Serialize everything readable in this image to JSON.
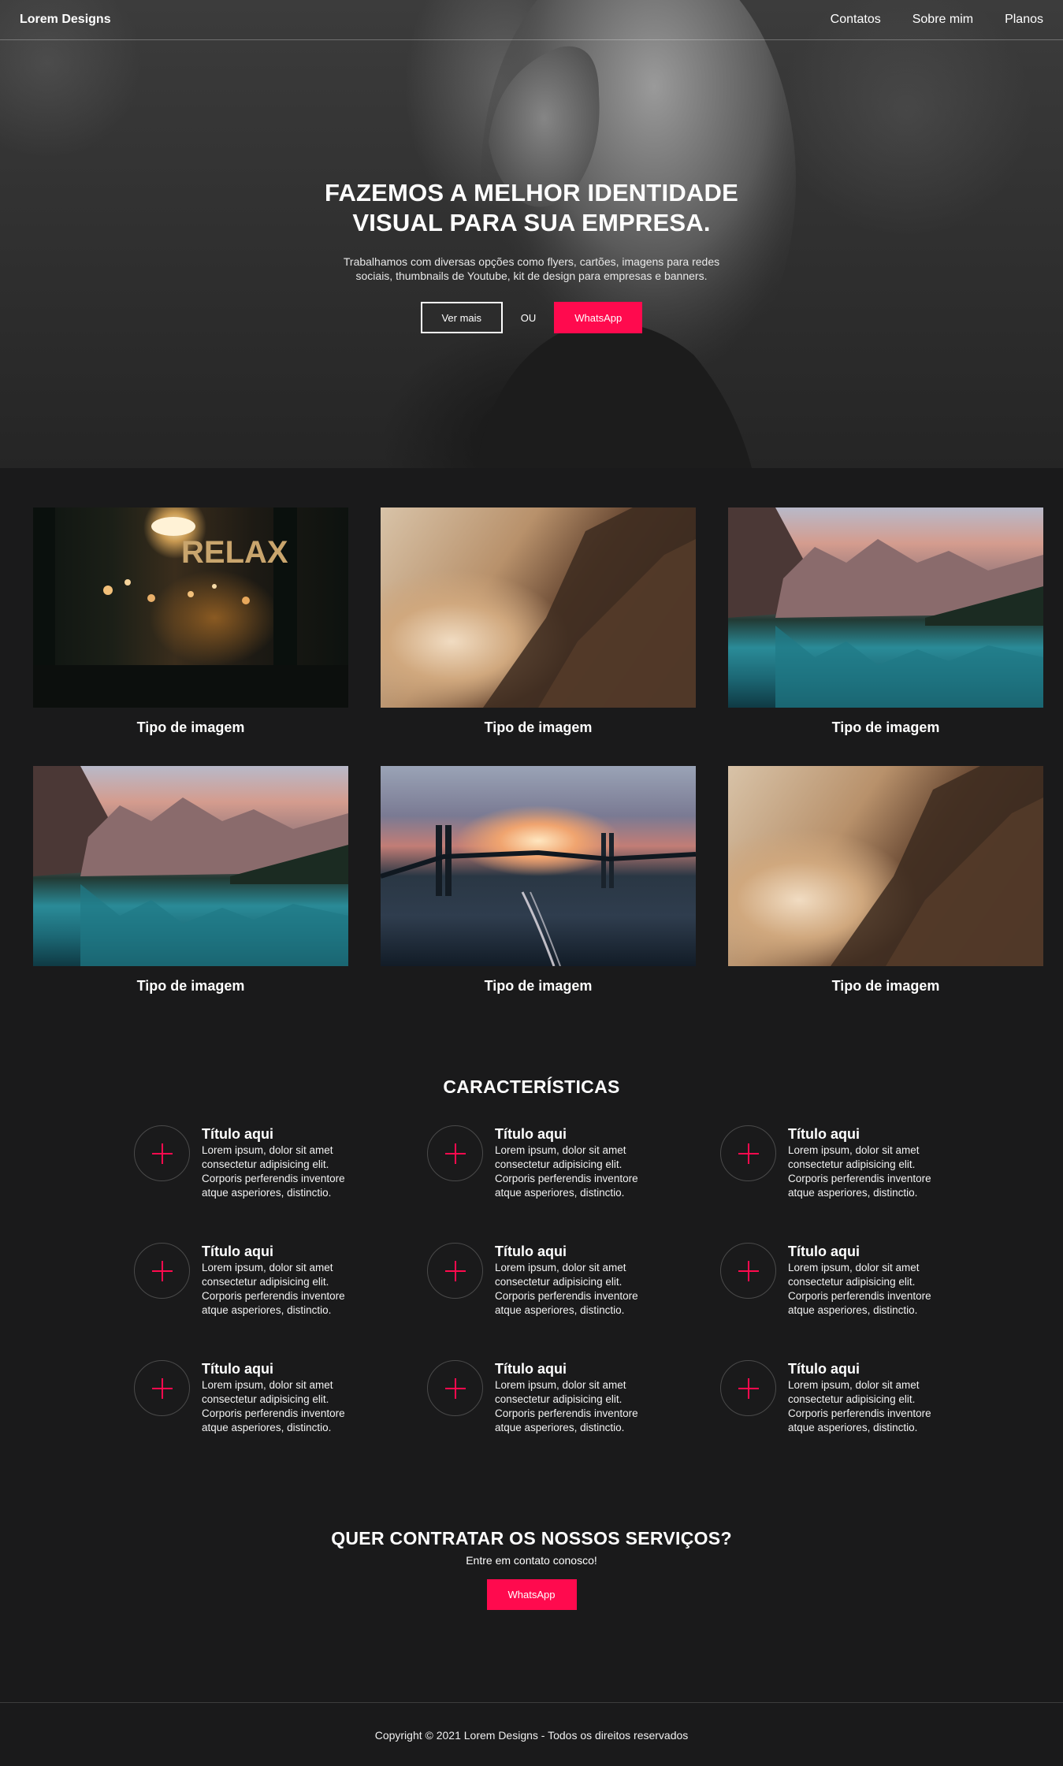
{
  "nav": {
    "brand": "Lorem Designs",
    "links": [
      "Contatos",
      "Sobre mim",
      "Planos"
    ]
  },
  "hero": {
    "title": "FAZEMOS A MELHOR IDENTIDADE VISUAL PARA SUA EMPRESA.",
    "subtitle": "Trabalhamos com diversas opções como flyers, cartões, imagens para redes sociais, thumbnails de Youtube, kit de design para empresas e banners.",
    "primary_label": "Ver mais",
    "or_label": "OU",
    "whatsapp_label": "WhatsApp"
  },
  "gallery": {
    "items": [
      {
        "title": "Tipo de imagem",
        "image": "bar-window-relax"
      },
      {
        "title": "Tipo de imagem",
        "image": "mountain-clouds"
      },
      {
        "title": "Tipo de imagem",
        "image": "mountain-lake"
      },
      {
        "title": "Tipo de imagem",
        "image": "mountain-lake"
      },
      {
        "title": "Tipo de imagem",
        "image": "bridge-sunset"
      },
      {
        "title": "Tipo de imagem",
        "image": "mountain-clouds"
      }
    ],
    "bar_sign": "RELAX"
  },
  "features": {
    "heading": "CARACTERÍSTICAS",
    "items": [
      {
        "title": "Título aqui",
        "text": "Lorem ipsum, dolor sit amet consectetur adipisicing elit. Corporis perferendis inventore atque asperiores, distinctio."
      },
      {
        "title": "Título aqui",
        "text": "Lorem ipsum, dolor sit amet consectetur adipisicing elit. Corporis perferendis inventore atque asperiores, distinctio."
      },
      {
        "title": "Título aqui",
        "text": "Lorem ipsum, dolor sit amet consectetur adipisicing elit. Corporis perferendis inventore atque asperiores, distinctio."
      },
      {
        "title": "Título aqui",
        "text": "Lorem ipsum, dolor sit amet consectetur adipisicing elit. Corporis perferendis inventore atque asperiores, distinctio."
      },
      {
        "title": "Título aqui",
        "text": "Lorem ipsum, dolor sit amet consectetur adipisicing elit. Corporis perferendis inventore atque asperiores, distinctio."
      },
      {
        "title": "Título aqui",
        "text": "Lorem ipsum, dolor sit amet consectetur adipisicing elit. Corporis perferendis inventore atque asperiores, distinctio."
      },
      {
        "title": "Título aqui",
        "text": "Lorem ipsum, dolor sit amet consectetur adipisicing elit. Corporis perferendis inventore atque asperiores, distinctio."
      },
      {
        "title": "Título aqui",
        "text": "Lorem ipsum, dolor sit amet consectetur adipisicing elit. Corporis perferendis inventore atque asperiores, distinctio."
      },
      {
        "title": "Título aqui",
        "text": "Lorem ipsum, dolor sit amet consectetur adipisicing elit. Corporis perferendis inventore atque asperiores, distinctio."
      }
    ],
    "icon": "plus-icon"
  },
  "cta": {
    "heading": "QUER CONTRATAR OS NOSSOS SERVIÇOS?",
    "text": "Entre em contato conosco!",
    "button_label": "WhatsApp"
  },
  "footer": {
    "text": "Copyright © 2021 Lorem Designs - Todos os direitos reservados"
  },
  "colors": {
    "accent": "#ff0a4e",
    "background": "#1a1a1b",
    "text": "#ffffff"
  }
}
